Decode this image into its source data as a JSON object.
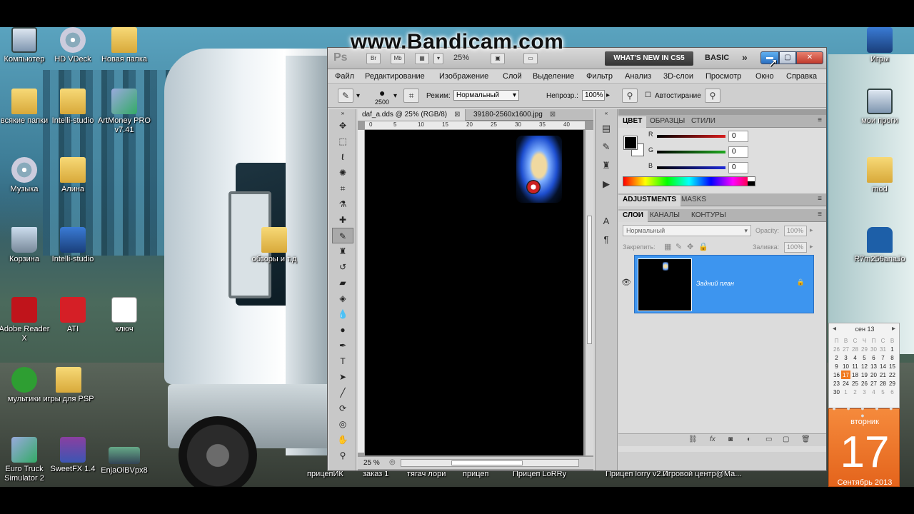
{
  "watermark": "www.Bandicam.com",
  "desktop": {
    "icons": [
      {
        "label": "Компьютер",
        "icon": "computer-icon"
      },
      {
        "label": "HD VDeck",
        "icon": "hd-vdeck-icon"
      },
      {
        "label": "Новая папка",
        "icon": "folder-icon"
      },
      {
        "label": "всякие папки",
        "icon": "folder-icon"
      },
      {
        "label": "Intelli-studio",
        "icon": "folder-icon"
      },
      {
        "label": "ArtMoney PRO v7.41",
        "icon": "artmoney-icon"
      },
      {
        "label": "Музыка",
        "icon": "music-cd-icon"
      },
      {
        "label": "Алина",
        "icon": "folder-icon"
      },
      {
        "label": "Корзина",
        "icon": "recycle-bin-icon"
      },
      {
        "label": "Intelli-studio",
        "icon": "intelli-studio-icon"
      },
      {
        "label": "обзоры и т.д",
        "icon": "folder-icon"
      },
      {
        "label": "Adobe Reader X",
        "icon": "adobe-reader-icon"
      },
      {
        "label": "ATI",
        "icon": "ati-icon"
      },
      {
        "label": "ключ",
        "icon": "document-icon"
      },
      {
        "label": "мультики",
        "icon": "media-player-icon"
      },
      {
        "label": "игры для PSP",
        "icon": "folder-icon"
      },
      {
        "label": "Euro Truck Simulator 2",
        "icon": "euro-truck-icon"
      },
      {
        "label": "SweetFX 1.4",
        "icon": "winrar-icon"
      },
      {
        "label": "EnjaOlBVpx8",
        "icon": "image-icon"
      },
      {
        "label": "Игры",
        "icon": "games-icon"
      },
      {
        "label": "мои проги",
        "icon": "programs-icon"
      },
      {
        "label": "mod",
        "icon": "folder-icon"
      },
      {
        "label": "R7m256anaJo",
        "icon": "tshirt-icon"
      }
    ],
    "bottom_labels": [
      "прицепИК",
      "заказ 1",
      "тягач лори",
      "прицеп",
      "Прицеп LoRRy",
      "Прицеп lorry v2.0",
      "Игровой центр@Ма..."
    ]
  },
  "calendar": {
    "month_header": "сен 13",
    "weekdays": [
      "П",
      "В",
      "С",
      "Ч",
      "П",
      "С",
      "В"
    ],
    "weeks": [
      [
        "26",
        "27",
        "28",
        "29",
        "30",
        "31",
        "1"
      ],
      [
        "2",
        "3",
        "4",
        "5",
        "6",
        "7",
        "8"
      ],
      [
        "9",
        "10",
        "11",
        "12",
        "13",
        "14",
        "15"
      ],
      [
        "16",
        "17",
        "18",
        "19",
        "20",
        "21",
        "22"
      ],
      [
        "23",
        "24",
        "25",
        "26",
        "27",
        "28",
        "29"
      ],
      [
        "30",
        "1",
        "2",
        "3",
        "4",
        "5",
        "6"
      ]
    ],
    "day_of_week": "вторник",
    "day": "17",
    "month_year": "Сентябрь 2013"
  },
  "photoshop": {
    "logo": "Ps",
    "appbar": {
      "btn_br": "Br",
      "btn_mb": "Mb",
      "zoom": "25%",
      "whats_new": "WHAT'S NEW IN CS5",
      "workspace": "BASIC",
      "more": "»"
    },
    "menu": [
      "Файл",
      "Редактирование",
      "Изображение",
      "Слой",
      "Выделение",
      "Фильтр",
      "Анализ",
      "3D-слои",
      "Просмотр",
      "Окно",
      "Справка"
    ],
    "options": {
      "brush_size": "2500",
      "mode_label": "Режим:",
      "mode_value": "Нормальный",
      "opacity_label": "Непрозр.:",
      "opacity_value": "100%",
      "auto_erase": "Автостирание"
    },
    "document": {
      "tabs": [
        {
          "label": "daf_a.dds @ 25% (RGB/8)",
          "close": "⊠"
        },
        {
          "label": "39180-2560x1600.jpg",
          "close": "⊠"
        }
      ],
      "ruler_ticks": [
        "0",
        "5",
        "10",
        "15",
        "20",
        "25",
        "30",
        "35",
        "40"
      ],
      "status_zoom": "25 %"
    },
    "color_panel": {
      "tabs": [
        "ЦВЕТ",
        "ОБРАЗЦЫ",
        "СТИЛИ"
      ],
      "channels": [
        {
          "label": "R",
          "value": "0",
          "color": "#d81e1e"
        },
        {
          "label": "G",
          "value": "0",
          "color": "#1fa81f"
        },
        {
          "label": "B",
          "value": "0",
          "color": "#1e2ad8"
        }
      ]
    },
    "adjust_panel": {
      "tabs": [
        "ADJUSTMENTS",
        "MASKS"
      ]
    },
    "layers_panel": {
      "tabs": [
        "СЛОИ",
        "КАНАЛЫ",
        "КОНТУРЫ"
      ],
      "blend_mode": "Нормальный",
      "opacity_label": "Opacity:",
      "opacity_value": "100%",
      "lock_label": "Закрепить:",
      "fill_label": "Заливка:",
      "fill_value": "100%",
      "layer_name": "Задний план"
    }
  }
}
